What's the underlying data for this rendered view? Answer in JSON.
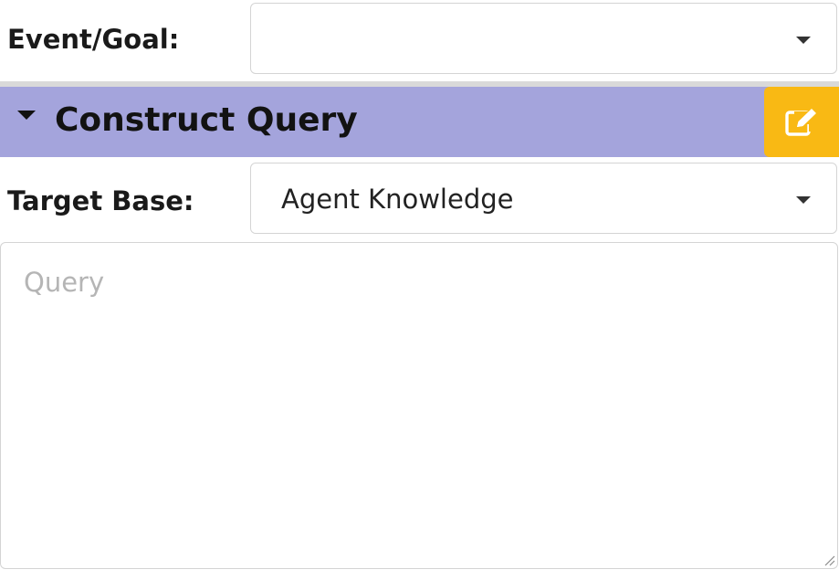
{
  "event_goal": {
    "label": "Event/Goal:",
    "value": ""
  },
  "construct_query": {
    "title": "Construct Query",
    "edit_icon": "edit-icon",
    "caret_icon": "caret-down-icon"
  },
  "target_base": {
    "label": "Target Base:",
    "value": "Agent Knowledge"
  },
  "query": {
    "placeholder": "Query",
    "value": ""
  },
  "colors": {
    "header_bg": "#a4a4dc",
    "edit_button_bg": "#f9b914",
    "divider": "#d9d9d9"
  }
}
